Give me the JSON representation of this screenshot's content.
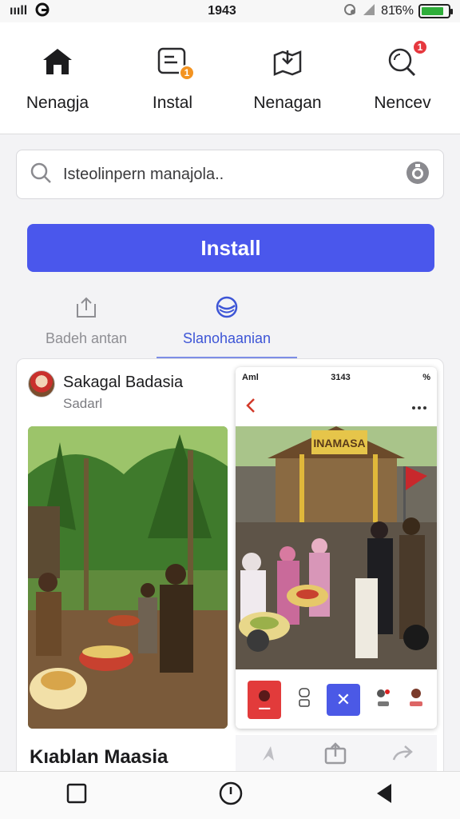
{
  "status_bar": {
    "carrier": "ıııll",
    "time": "1943",
    "battery_text": "81̄6%",
    "battery_level": 0.85
  },
  "top_nav": {
    "items": [
      {
        "label": "Nenagja",
        "icon": "home-icon"
      },
      {
        "label": "Instal",
        "icon": "install-icon",
        "badge": "1"
      },
      {
        "label": "Nenagan",
        "icon": "map-icon"
      },
      {
        "label": "Nencev",
        "icon": "search-icon",
        "badge": "1"
      }
    ]
  },
  "search": {
    "placeholder": "Isteolinpern manajola..",
    "icon": "search-icon",
    "mic_icon": "mic-icon"
  },
  "install_button": {
    "label": "Install"
  },
  "subtabs": [
    {
      "label": "Badeh antan",
      "icon": "share-icon",
      "active": false
    },
    {
      "label": "Slanohaanian",
      "icon": "globe-icon",
      "active": true
    }
  ],
  "post": {
    "author": "Sakagal Badasia",
    "subtitle": "Sadarl",
    "caption": "Kıablan Maasia"
  },
  "phone_preview": {
    "carrier": "Aml",
    "time": "3143",
    "battery": "%",
    "sign_text": "INAMASA"
  },
  "colors": {
    "accent": "#4a57ec",
    "badge_orange": "#f39321",
    "badge_red": "#e6383e"
  }
}
